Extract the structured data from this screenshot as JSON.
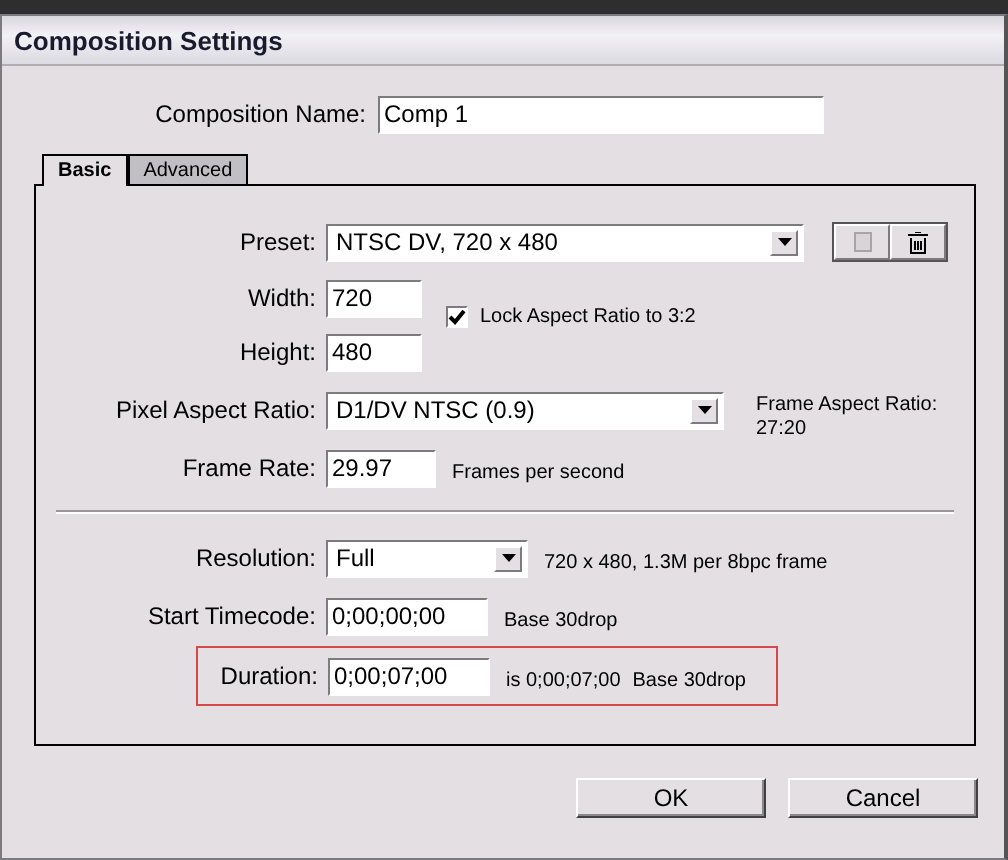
{
  "window": {
    "title": "Composition Settings"
  },
  "composition_name": {
    "label": "Composition Name:",
    "value": "Comp 1"
  },
  "tabs": [
    {
      "label": "Basic",
      "selected": true
    },
    {
      "label": "Advanced",
      "selected": false
    }
  ],
  "preset": {
    "label": "Preset:",
    "value": "NTSC DV, 720 x 480"
  },
  "width": {
    "label": "Width:",
    "value": "720"
  },
  "height": {
    "label": "Height:",
    "value": "480"
  },
  "lock_aspect": {
    "label": "Lock Aspect Ratio to 3:2",
    "checked": true
  },
  "pixel_aspect": {
    "label": "Pixel Aspect Ratio:",
    "value": "D1/DV NTSC (0.9)"
  },
  "frame_aspect": {
    "label": "Frame Aspect Ratio:",
    "value": "27:20"
  },
  "frame_rate": {
    "label": "Frame Rate:",
    "value": "29.97",
    "unit": "Frames per second"
  },
  "resolution": {
    "label": "Resolution:",
    "value": "Full",
    "info": "720 x 480, 1.3M per 8bpc frame"
  },
  "start_timecode": {
    "label": "Start Timecode:",
    "value": "0;00;00;00",
    "info": "Base 30drop"
  },
  "duration": {
    "label": "Duration:",
    "value": "0;00;07;00",
    "equivalent": "is 0;00;07;00",
    "info": "Base 30drop",
    "highlighted": true
  },
  "buttons": [
    "OK",
    "Cancel"
  ]
}
